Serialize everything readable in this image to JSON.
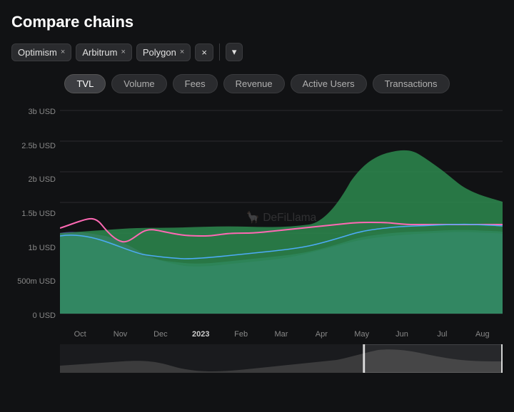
{
  "page": {
    "title": "Compare chains"
  },
  "filters": {
    "chains": [
      {
        "label": "Optimism",
        "id": "optimism"
      },
      {
        "label": "Arbitrum",
        "id": "arbitrum"
      },
      {
        "label": "Polygon",
        "id": "polygon"
      }
    ],
    "clear_label": "×",
    "dropdown_label": "▾"
  },
  "metrics": {
    "tabs": [
      {
        "label": "TVL",
        "id": "tvl",
        "active": true
      },
      {
        "label": "Volume",
        "id": "volume",
        "active": false
      },
      {
        "label": "Fees",
        "id": "fees",
        "active": false
      },
      {
        "label": "Revenue",
        "id": "revenue",
        "active": false
      },
      {
        "label": "Active Users",
        "id": "active-users",
        "active": false
      },
      {
        "label": "Transactions",
        "id": "transactions",
        "active": false
      }
    ]
  },
  "chart": {
    "y_labels": [
      "3b USD",
      "2.5b USD",
      "2b USD",
      "1.5b USD",
      "1b USD",
      "500m USD",
      "0 USD"
    ],
    "x_labels": [
      "Oct",
      "Nov",
      "Dec",
      "2023",
      "Feb",
      "Mar",
      "Apr",
      "May",
      "Jun",
      "Jul",
      "Aug"
    ],
    "watermark": "DeFiLlama",
    "colors": {
      "optimism": "#ff69b4",
      "arbitrum": "#4dabf7",
      "polygon": "#7950f2",
      "green_fill": "#2d8a4e"
    }
  }
}
